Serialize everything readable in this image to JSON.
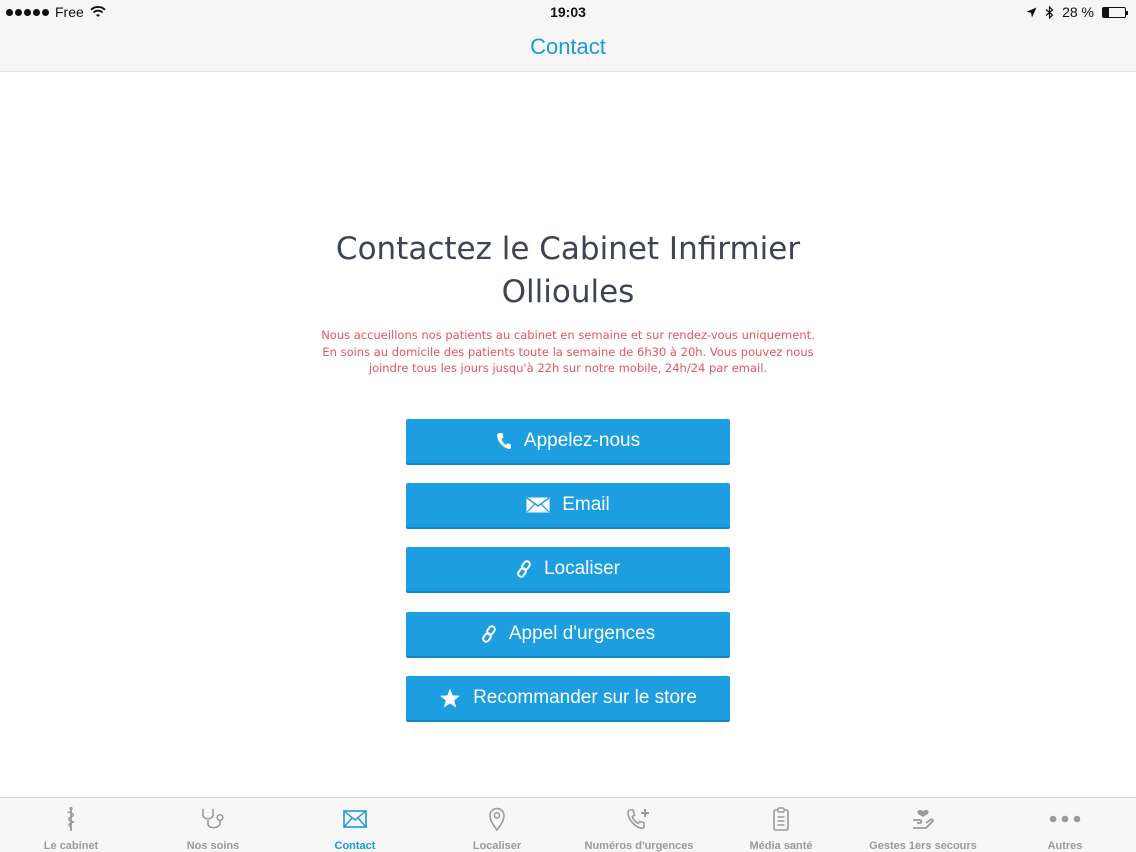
{
  "status_bar": {
    "carrier": "Free",
    "time": "19:03",
    "battery_text": "28 %",
    "battery_level": 0.28
  },
  "nav": {
    "title": "Contact"
  },
  "content": {
    "heading": "Contactez le Cabinet Infirmier Ollioules",
    "description": "Nous accueillons nos patients au cabinet en semaine et sur rendez-vous uniquement. En soins au domicile des patients toute la semaine de 6h30 à 20h. Vous pouvez nous joindre tous les jours jusqu'à 22h sur notre mobile, 24h/24 par email.",
    "buttons": [
      {
        "label": "Appelez-nous",
        "icon": "phone-icon"
      },
      {
        "label": "Email",
        "icon": "envelope-icon"
      },
      {
        "label": "Localiser",
        "icon": "link-icon"
      },
      {
        "label": "Appel d'urgences",
        "icon": "link-icon"
      },
      {
        "label": "Recommander sur le store",
        "icon": "star-icon"
      }
    ]
  },
  "tabs": [
    {
      "label": "Le cabinet",
      "icon": "caduceus-icon",
      "active": false
    },
    {
      "label": "Nos soins",
      "icon": "stethoscope-icon",
      "active": false
    },
    {
      "label": "Contact",
      "icon": "envelope-icon",
      "active": true
    },
    {
      "label": "Localiser",
      "icon": "map-pin-icon",
      "active": false
    },
    {
      "label": "Numéros d'urgences",
      "icon": "phone-plus-icon",
      "active": false
    },
    {
      "label": "Média santé",
      "icon": "clipboard-icon",
      "active": false
    },
    {
      "label": "Gestes 1ers secours",
      "icon": "hand-heart-icon",
      "active": false
    },
    {
      "label": "Autres",
      "icon": "more-dots-icon",
      "active": false
    }
  ],
  "colors": {
    "accent": "#1a9ad6",
    "button": "#1c9ee0",
    "description": "#e8555b",
    "heading": "#3d4452",
    "tab_inactive": "#9a9a9a"
  }
}
